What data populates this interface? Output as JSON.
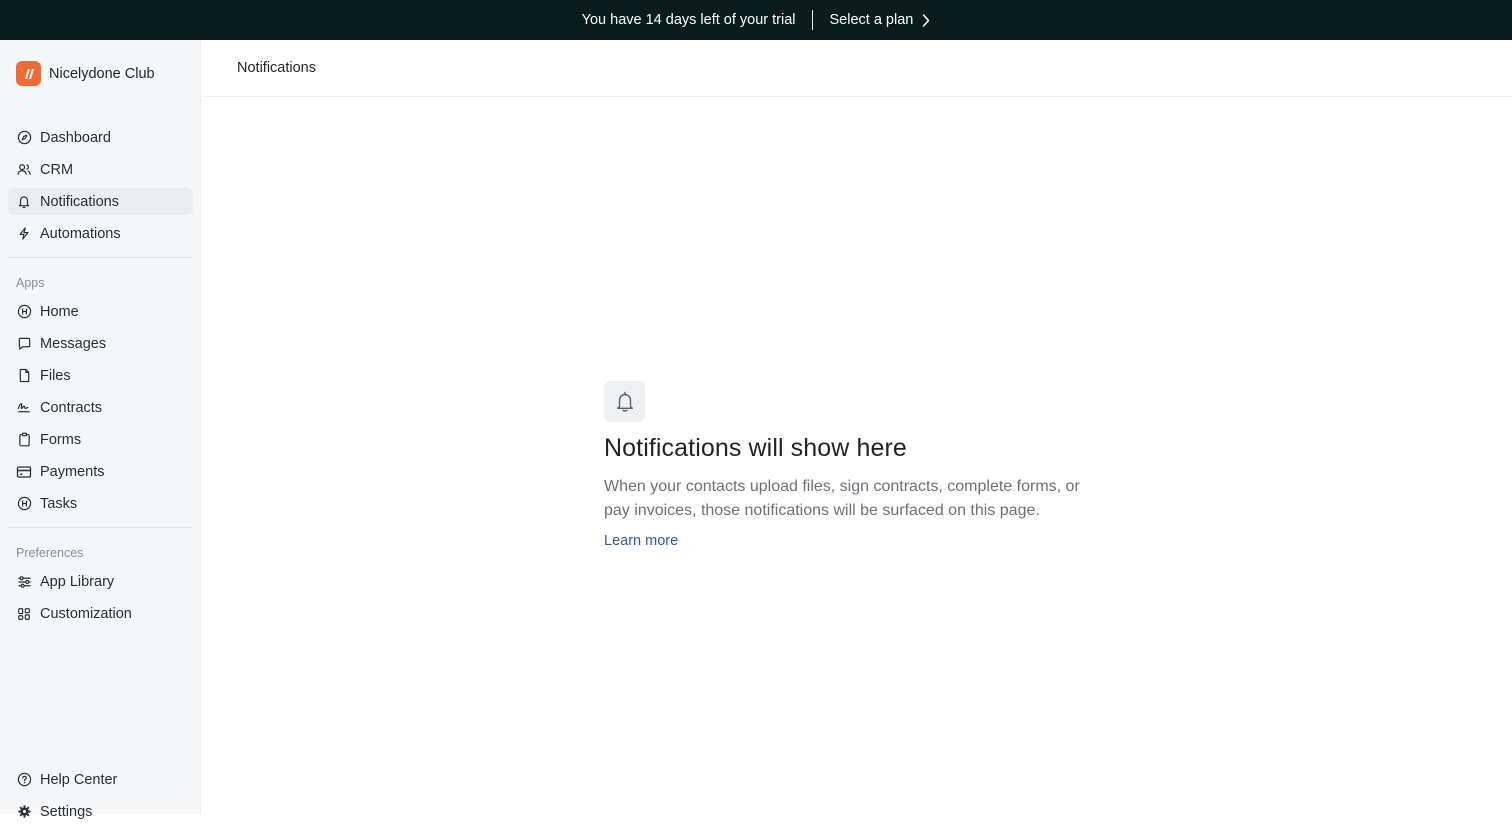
{
  "banner": {
    "trial_text": "You have 14 days left of your trial",
    "plan_link": "Select a plan",
    "background": "#0b1c1c"
  },
  "brand": {
    "name": "Nicelydone Club",
    "logo_color": "#f06a34"
  },
  "sidebar": {
    "main_items": [
      {
        "label": "Dashboard",
        "icon": "compass-icon"
      },
      {
        "label": "CRM",
        "icon": "users-icon"
      },
      {
        "label": "Notifications",
        "icon": "bell-icon",
        "active": true
      },
      {
        "label": "Automations",
        "icon": "lightning-icon"
      }
    ],
    "apps_label": "Apps",
    "apps_items": [
      {
        "label": "Home",
        "icon": "home-app-icon"
      },
      {
        "label": "Messages",
        "icon": "message-icon"
      },
      {
        "label": "Files",
        "icon": "file-icon"
      },
      {
        "label": "Contracts",
        "icon": "signature-icon"
      },
      {
        "label": "Forms",
        "icon": "clipboard-icon"
      },
      {
        "label": "Payments",
        "icon": "credit-card-icon"
      },
      {
        "label": "Tasks",
        "icon": "tasks-icon"
      }
    ],
    "preferences_label": "Preferences",
    "preferences_items": [
      {
        "label": "App Library",
        "icon": "sliders-icon"
      },
      {
        "label": "Customization",
        "icon": "grid-icon"
      }
    ],
    "bottom_items": [
      {
        "label": "Help Center",
        "icon": "help-icon"
      },
      {
        "label": "Settings",
        "icon": "gear-icon"
      }
    ]
  },
  "header": {
    "title": "Notifications"
  },
  "empty_state": {
    "heading": "Notifications will show here",
    "description": "When your contacts upload files, sign contracts, complete forms, or pay invoices, those notifications will be surfaced on this page.",
    "link": "Learn more",
    "link_color": "#2f5d8a"
  }
}
